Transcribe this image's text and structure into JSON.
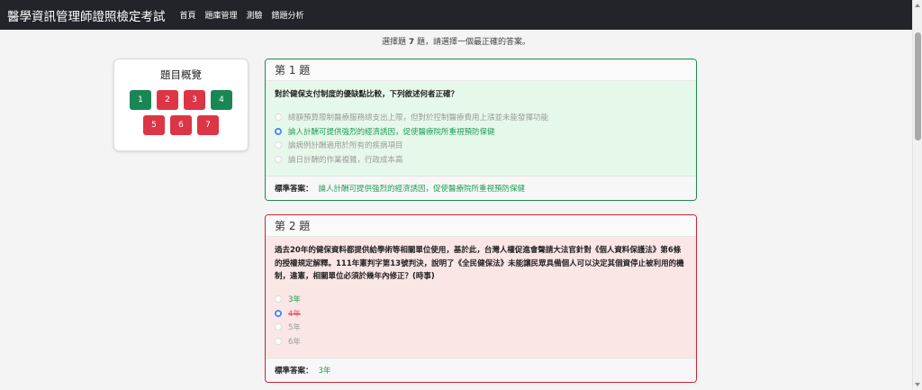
{
  "navbar": {
    "brand": "醫學資訊管理師證照檢定考試",
    "links": [
      "首頁",
      "題庫管理",
      "測驗",
      "錯題分析"
    ]
  },
  "instruction": {
    "prefix": "選擇題 ",
    "count": "7",
    "suffix": " 題，請選擇一個最正確的答案。"
  },
  "overview": {
    "title": "題目概覽",
    "items": [
      {
        "label": "1",
        "status": "correct"
      },
      {
        "label": "2",
        "status": "wrong"
      },
      {
        "label": "3",
        "status": "wrong"
      },
      {
        "label": "4",
        "status": "correct"
      },
      {
        "label": "5",
        "status": "wrong"
      },
      {
        "label": "6",
        "status": "wrong"
      },
      {
        "label": "7",
        "status": "wrong"
      }
    ]
  },
  "questions": [
    {
      "header": "第 1 題",
      "text": "對於健保支付制度的優缺點比較，下列敘述何者正確？",
      "options": [
        "總額預算限制醫療服務總支出上限，但對於控制醫療費用上漲並未能發揮功能",
        "論人計酬可提供強烈的經濟誘因，促使醫療院所重視預防保健",
        "論病例計酬適用於所有的疾病項目",
        "論日計酬的作業複雜，行政成本高"
      ],
      "selected_index": 1,
      "result": "correct",
      "standard_label": "標準答案：",
      "standard_answer": "論人計酬可提供強烈的經濟誘因，促使醫療院所重視預防保健"
    },
    {
      "header": "第 2 題",
      "text": "過去20年的健保資料都提供給學術等相關單位使用，基於此，台灣人權促進會聲請大法官針對《個人資料保護法》第6條的授權規定解釋。111年憲判字第13號判決，說明了《全民健保法》未能讓民眾具備個人可以決定其個資停止被利用的機制，違憲，相關單位必須於幾年內修正？(時事)",
      "options": [
        "3年",
        "4年",
        "5年",
        "6年"
      ],
      "selected_index": 1,
      "correct_index": 0,
      "result": "wrong",
      "standard_label": "標準答案：",
      "standard_answer": "3年"
    }
  ],
  "colors": {
    "navbar_bg": "#212529",
    "correct": "#198754",
    "wrong": "#dc3545",
    "radio_checked": "#4a8cf2"
  }
}
